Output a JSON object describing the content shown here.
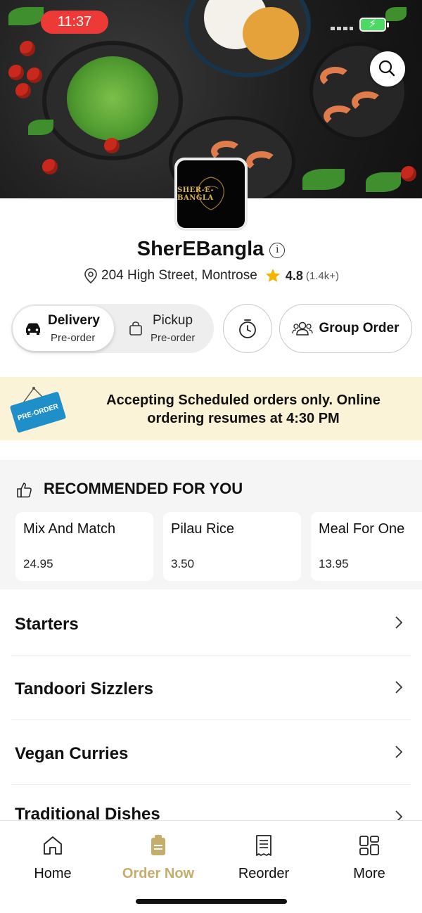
{
  "status_bar": {
    "time": "11:37"
  },
  "header": {
    "logo_text": "SHER-E-BANGLA"
  },
  "restaurant": {
    "name": "SherEBangla",
    "address": "204 High Street, Montrose",
    "rating": "4.8",
    "rating_count": "(1.4k+)",
    "star_color": "#f5b400"
  },
  "order_modes": [
    {
      "label": "Delivery",
      "sub": "Pre-order",
      "selected": true
    },
    {
      "label": "Pickup",
      "sub": "Pre-order",
      "selected": false
    }
  ],
  "group_order": {
    "label": "Group Order"
  },
  "banner": {
    "tag_text": "PRE-ORDER",
    "message": "Accepting Scheduled orders only. Online ordering resumes at 4:30 PM"
  },
  "recommended": {
    "title": "RECOMMENDED FOR YOU",
    "items": [
      {
        "name": "Mix And Match",
        "price": "24.95"
      },
      {
        "name": "Pilau Rice",
        "price": "3.50"
      },
      {
        "name": "Meal For One",
        "price": "13.95"
      }
    ]
  },
  "categories": [
    {
      "label": "Starters"
    },
    {
      "label": "Tandoori Sizzlers"
    },
    {
      "label": "Vegan Curries"
    },
    {
      "label": "Traditional Dishes"
    }
  ],
  "bottom_nav": [
    {
      "label": "Home",
      "icon": "home-icon",
      "active": false
    },
    {
      "label": "Order Now",
      "icon": "order-bag-icon",
      "active": true
    },
    {
      "label": "Reorder",
      "icon": "receipt-icon",
      "active": false
    },
    {
      "label": "More",
      "icon": "grid-icon",
      "active": false
    }
  ],
  "colors": {
    "accent": "#c5ad6c",
    "status_time_bg": "#ee3a36",
    "banner_bg": "#fbf3d8",
    "preorder_tag": "#1f8fc9"
  }
}
